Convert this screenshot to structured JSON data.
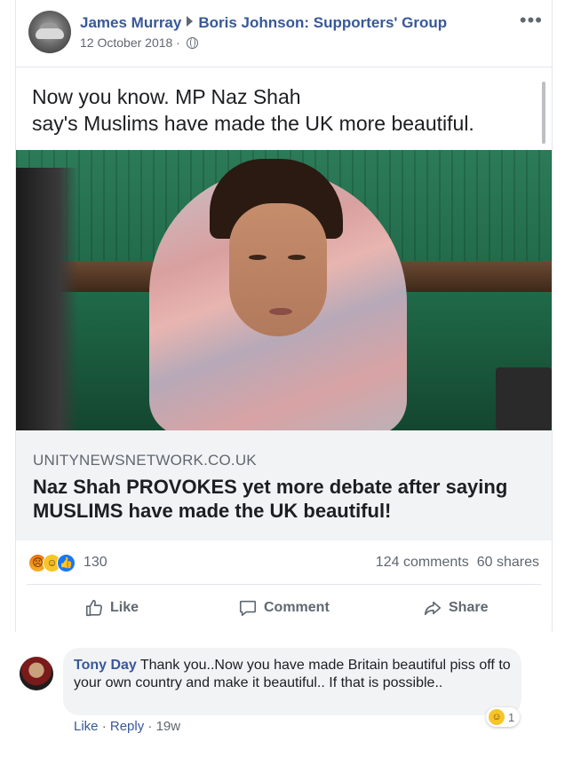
{
  "post": {
    "author": "James Murray",
    "group": "Boris Johnson: Supporters' Group",
    "date": "12 October 2018 ·",
    "more_label": "•••",
    "text_line1": "Now you know. MP Naz Shah",
    "text_line2": "say's Muslims have made the UK more beautiful.",
    "privacy_icon": "globe-icon"
  },
  "link_preview": {
    "domain": "UNITYNEWSNETWORK.CO.UK",
    "title": "Naz Shah PROVOKES yet more debate after saying MUSLIMS have made the UK beautiful!"
  },
  "engagement": {
    "reaction_icons": [
      "angry-reaction-icon",
      "haha-reaction-icon",
      "like-reaction-icon"
    ],
    "reaction_count": "130",
    "comments": "124 comments",
    "shares": "60 shares"
  },
  "actions": {
    "like": "Like",
    "comment": "Comment",
    "share": "Share"
  },
  "comment": {
    "name": "Tony Day",
    "text": "Thank you..Now you have made Britain beautiful piss off to your own country and make it beautiful.. If that is possible..",
    "reaction_count": "1",
    "like": "Like",
    "reply": "Reply",
    "time": "19w",
    "sep": "·"
  },
  "colors": {
    "link_blue": "#385898",
    "secondary_text": "#606770",
    "like_blue": "#1877f2",
    "preview_bg": "#f2f3f5"
  }
}
